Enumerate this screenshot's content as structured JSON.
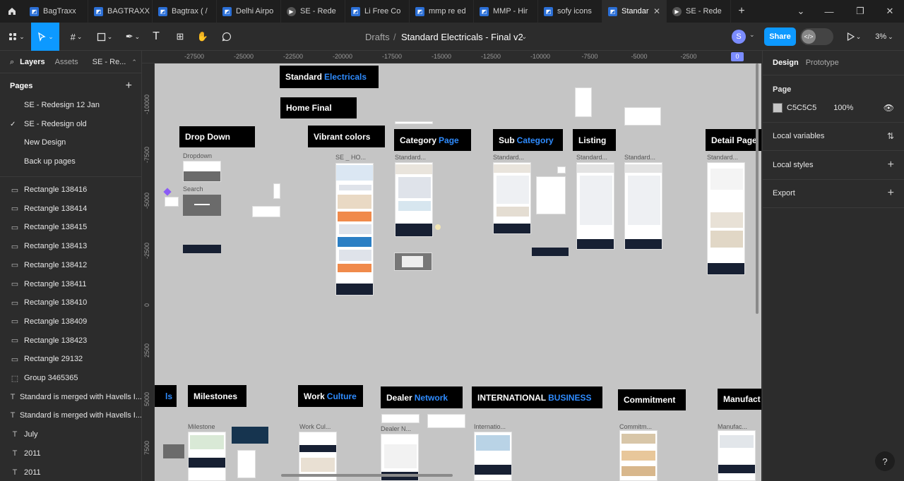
{
  "tabs": [
    {
      "label": "BagTraxx",
      "icon": "figma-file-icon"
    },
    {
      "label": "BAGTRAXX",
      "icon": "figma-file-icon"
    },
    {
      "label": "Bagtrax ( /",
      "icon": "figma-file-icon"
    },
    {
      "label": "Delhi Airpo",
      "icon": "figma-file-icon"
    },
    {
      "label": "SE - Rede",
      "icon": "prototype-play-icon"
    },
    {
      "label": "Li Free Co",
      "icon": "figma-file-icon"
    },
    {
      "label": "mmp re ed",
      "icon": "figma-file-icon"
    },
    {
      "label": "MMP - Hir",
      "icon": "figma-file-icon"
    },
    {
      "label": "sofy icons",
      "icon": "figma-file-icon"
    },
    {
      "label": "Standar",
      "icon": "figma-file-icon",
      "active": true
    },
    {
      "label": "SE - Rede",
      "icon": "prototype-play-icon"
    }
  ],
  "toolbar": {
    "breadcrumb_parent": "Drafts",
    "breadcrumb_sep": "/",
    "file_name": "Standard Electricals - Final v2",
    "avatar": "S",
    "share_label": "Share",
    "zoom": "3%"
  },
  "left": {
    "tab_layers": "Layers",
    "tab_assets": "Assets",
    "page_select": "SE - Re...",
    "pages_heading": "Pages",
    "pages": [
      {
        "label": "SE - Redesign 12 Jan",
        "current": false
      },
      {
        "label": "SE - Redesign old",
        "current": true
      },
      {
        "label": "New Design",
        "current": false
      },
      {
        "label": "Back up pages",
        "current": false
      }
    ],
    "layers": [
      {
        "label": "Rectangle 138416",
        "type": "rect"
      },
      {
        "label": "Rectangle 138414",
        "type": "rect"
      },
      {
        "label": "Rectangle 138415",
        "type": "rect"
      },
      {
        "label": "Rectangle 138413",
        "type": "rect"
      },
      {
        "label": "Rectangle 138412",
        "type": "rect"
      },
      {
        "label": "Rectangle 138411",
        "type": "rect"
      },
      {
        "label": "Rectangle 138410",
        "type": "rect"
      },
      {
        "label": "Rectangle 138409",
        "type": "rect"
      },
      {
        "label": "Rectangle 138423",
        "type": "rect"
      },
      {
        "label": "Rectangle 29132",
        "type": "rect"
      },
      {
        "label": "Group 3465365",
        "type": "group"
      },
      {
        "label": "Standard is merged with Havells I...",
        "type": "text"
      },
      {
        "label": "Standard is merged with Havells I...",
        "type": "text"
      },
      {
        "label": "July",
        "type": "text"
      },
      {
        "label": "2011",
        "type": "text"
      },
      {
        "label": "2011",
        "type": "text"
      }
    ]
  },
  "ruler": {
    "top": [
      "-27500",
      "-25000",
      "-22500",
      "-20000",
      "-17500",
      "-15000",
      "-12500",
      "-10000",
      "-7500",
      "-5000",
      "-2500",
      "0"
    ],
    "left": [
      "-10000",
      "-7500",
      "-5000",
      "-2500",
      "0",
      "2500",
      "5000",
      "7500"
    ]
  },
  "canvas": {
    "frames": {
      "standard_electricals": {
        "a": "Standard ",
        "b": "Electricals"
      },
      "home_final": "Home Final",
      "drop_down": "Drop Down",
      "vibrant_colors": "Vibrant colors",
      "category_page": {
        "a": "Category ",
        "b": "Page"
      },
      "sub_category": {
        "a": "Sub ",
        "b": "Category"
      },
      "listing": "Listing",
      "detail_page": "Detail Page",
      "cut_left": "ls",
      "milestones": "Milestones",
      "work_culture": {
        "a": "Work ",
        "b": "Culture"
      },
      "dealer_network": {
        "a": "Dealer ",
        "b": "Network"
      },
      "international_business": {
        "a": "INTERNATIONAL ",
        "b": "BUSINESS"
      },
      "commitment": "Commitment",
      "manufact": "Manufact"
    },
    "labels": {
      "dropdown": "Dropdown",
      "search": "Search",
      "se_ho": "SE _ HO...",
      "standard1": "Standard...",
      "standard2": "Standard...",
      "standard3": "Standard...",
      "standard4": "Standard...",
      "standard5": "Standard...",
      "milestone": "Milestone",
      "work_cul": "Work Cul...",
      "dealer_n": "Dealer N...",
      "internatio": "Internatio...",
      "commitm": "Commitm...",
      "manufac": "Manufac..."
    },
    "bg_color": "#C5C5C5"
  },
  "right": {
    "tab_design": "Design",
    "tab_prototype": "Prototype",
    "page_heading": "Page",
    "page_color": "C5C5C5",
    "page_opacity": "100%",
    "local_variables": "Local variables",
    "local_styles": "Local styles",
    "export": "Export"
  },
  "help": "?"
}
